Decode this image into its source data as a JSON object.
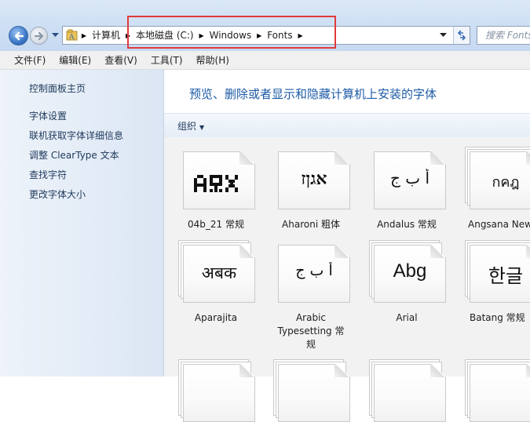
{
  "address": {
    "crumbs": [
      "计算机",
      "本地磁盘 (C:)",
      "Windows",
      "Fonts"
    ],
    "search_placeholder": "搜索 Fonts"
  },
  "menu": [
    "文件(F)",
    "编辑(E)",
    "查看(V)",
    "工具(T)",
    "帮助(H)"
  ],
  "sidebar": {
    "home": "控制面板主页",
    "links": [
      "字体设置",
      "联机获取字体详细信息",
      "调整 ClearType 文本",
      "查找字符",
      "更改字体大小"
    ]
  },
  "main": {
    "title": "预览、删除或者显示和隐藏计算机上安装的字体",
    "organize": "组织"
  },
  "fonts": [
    {
      "name": "04b_21 常规",
      "sample": "ARX",
      "stacked": false
    },
    {
      "name": "Aharoni 粗体",
      "sample": "אגןז",
      "stacked": false
    },
    {
      "name": "Andalus 常规",
      "sample": "أ ب ج",
      "stacked": false
    },
    {
      "name": "Angsana New",
      "sample": "กคฎ",
      "stacked": true
    },
    {
      "name": "Aparajita",
      "sample": "अबक",
      "stacked": true
    },
    {
      "name": "Arabic Typesetting 常规",
      "sample": "أ ب ج",
      "stacked": false
    },
    {
      "name": "Arial",
      "sample": "Abg",
      "stacked": true
    },
    {
      "name": "Batang 常规",
      "sample": "한글",
      "stacked": true
    }
  ],
  "colors": {
    "highlight": "#e23a3c",
    "link": "#1d5ba6"
  }
}
